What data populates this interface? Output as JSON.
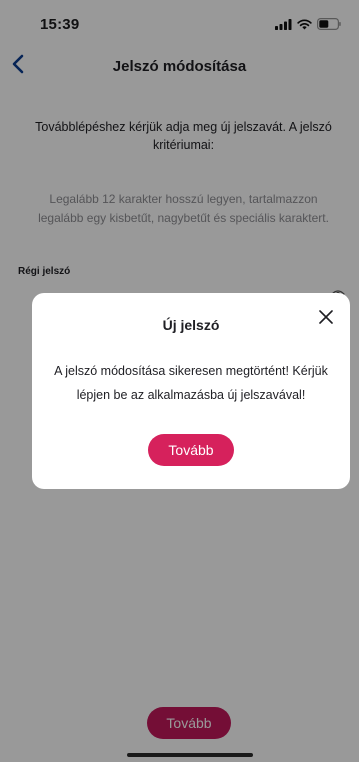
{
  "status_bar": {
    "time": "15:39",
    "icons": [
      "signal-icon",
      "wifi-icon",
      "battery-icon"
    ]
  },
  "nav": {
    "back_icon": "chevron-left-icon",
    "title": "Jelszó módosítása"
  },
  "content": {
    "intro": "Továbblépéshez kérjük adja meg új jelszavát. A jelszó kritériumai:",
    "criteria": "Legalább 12 karakter hosszú legyen, tartalmazzon legalább egy kisbetűt, nagybetűt és speciális karaktert.",
    "old_password_label": "Régi jelszó",
    "eye_icon": "eye-icon",
    "continue_label": "Tovább"
  },
  "modal": {
    "title": "Új jelszó",
    "close_icon": "close-icon",
    "message": "A jelszó módosítása sikeresen megtörtént! Kérjük lépjen be az alkalmazásba új jelszavával!",
    "continue_label": "Tovább"
  },
  "colors": {
    "accent": "#d6215c",
    "back_arrow": "#0a3d8f",
    "scrim": "rgba(0,0,0,0.40)"
  }
}
